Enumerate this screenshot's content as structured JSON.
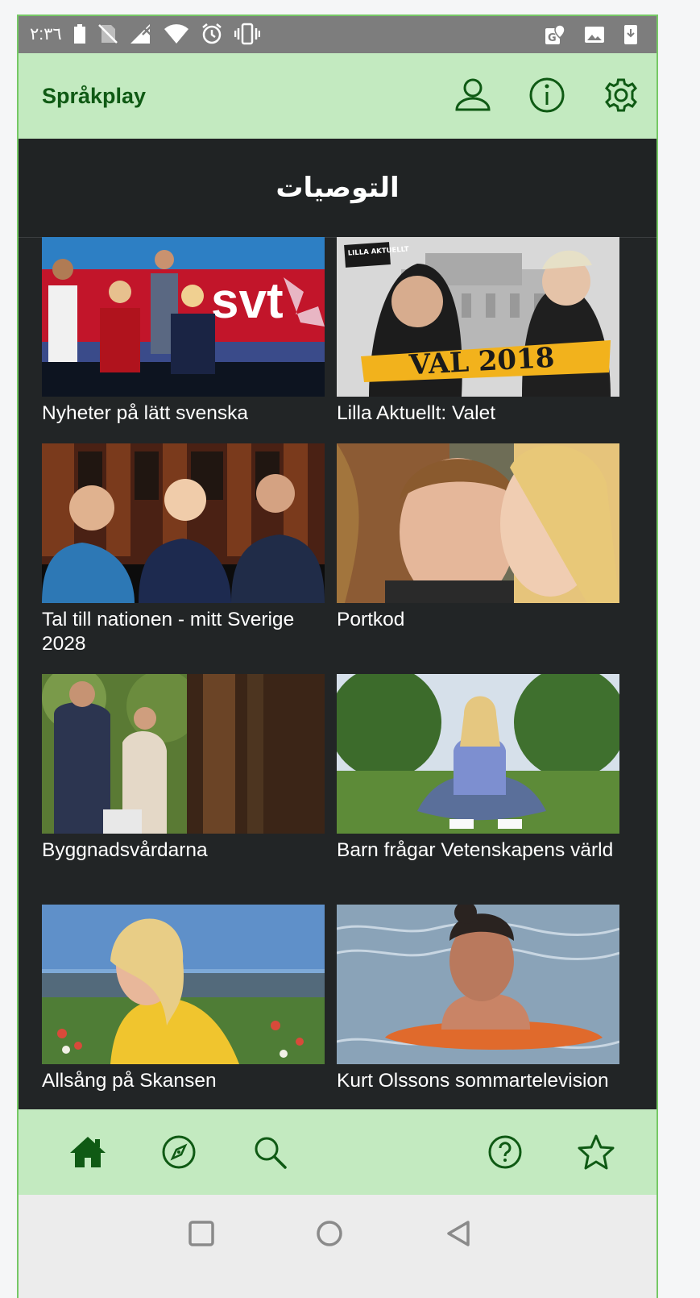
{
  "status_bar": {
    "time": "٢:٣٦"
  },
  "app_bar": {
    "title": "Språkplay"
  },
  "section": {
    "title": "التوصيات"
  },
  "cards": [
    {
      "title": "Nyheter på lätt svenska"
    },
    {
      "title": "Lilla Aktuellt: Valet",
      "badge": "LILLA AKTUELLT",
      "banner": "VAL 2018"
    },
    {
      "title": "Tal till nationen - mitt Sverige 2028"
    },
    {
      "title": "Portkod"
    },
    {
      "title": "Byggnadsvårdarna"
    },
    {
      "title": "Barn frågar Vetenskapens värld"
    },
    {
      "title": "Allsång på Skansen"
    },
    {
      "title": "Kurt Olssons sommartelevision"
    }
  ],
  "thumb_text": {
    "svt": "svt"
  },
  "colors": {
    "accent": "#c3eac0",
    "brand": "#0f5a14",
    "background": "#222526"
  }
}
